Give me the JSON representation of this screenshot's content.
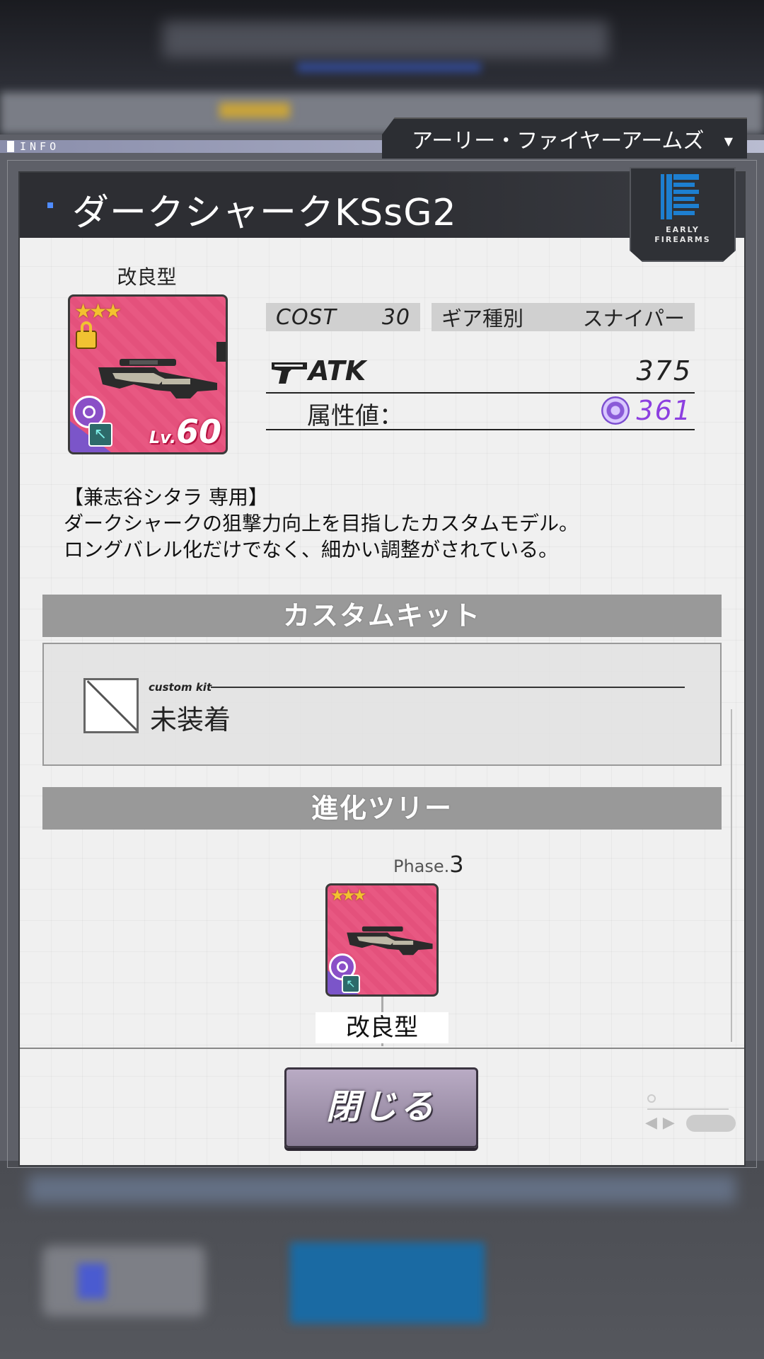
{
  "info_label": "INFO",
  "maker": {
    "name": "アーリー・ファイヤーアームズ",
    "logo_text": [
      "EARLY",
      "FIREARMS"
    ],
    "logo_icon": "early-firearms-logo"
  },
  "weapon": {
    "name": "ダークシャークKSsG2",
    "variant": "改良型",
    "stars": "★★★",
    "level_prefix": "Lv.",
    "level": "60",
    "cost_label": "COST",
    "cost_value": "30",
    "gear_type_label": "ギア種別",
    "gear_type_value": "スナイパー",
    "atk_label": "ATK",
    "atk_value": "375",
    "attr_label": "属性値：",
    "attr_value": "361",
    "description": [
      "【兼志谷シタラ 専用】",
      "ダークシャークの狙撃力向上を目指したカスタムモデル。",
      "ロングバレル化だけでなく、細かい調整がされている。"
    ]
  },
  "custom_kit": {
    "header": "カスタムキット",
    "small_label": "custom kit",
    "status": "未装着"
  },
  "evolution_tree": {
    "header": "進化ツリー",
    "phase_prefix": "Phase.",
    "phase_number": "3",
    "node_label": "改良型",
    "node_stars": "★★★"
  },
  "close_button": "閉じる",
  "colors": {
    "card_pink": "#e85882",
    "attr_purple": "#8c3fe0",
    "star_gold": "#f3c22f",
    "accent_blue": "#4f8cff",
    "button_lavender": "#a294b0"
  }
}
